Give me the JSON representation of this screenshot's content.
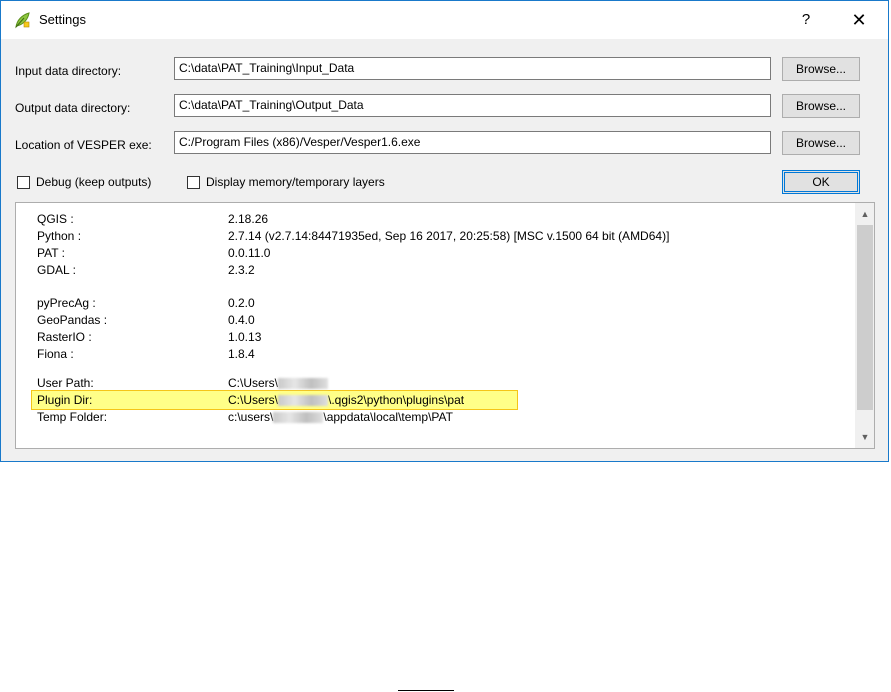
{
  "window": {
    "title": "Settings",
    "help_label": "?",
    "close_label": "✕"
  },
  "fields": [
    {
      "label": "Input data directory:",
      "value": "C:\\data\\PAT_Training\\Input_Data",
      "button": "Browse..."
    },
    {
      "label": "Output data directory:",
      "value": "C:\\data\\PAT_Training\\Output_Data",
      "button": "Browse..."
    },
    {
      "label": "Location of VESPER exe:",
      "value": "C:/Program Files (x86)/Vesper/Vesper1.6.exe",
      "button": "Browse..."
    }
  ],
  "options": {
    "debug_label": "Debug (keep outputs)",
    "debug_checked": false,
    "display_layers_label": "Display memory/temporary layers",
    "display_layers_checked": false,
    "ok_label": "OK"
  },
  "info": {
    "versions": [
      {
        "key": "QGIS :",
        "value": "2.18.26"
      },
      {
        "key": "Python :",
        "value": "2.7.14 (v2.7.14:84471935ed, Sep 16 2017, 20:25:58) [MSC v.1500 64 bit (AMD64)]"
      },
      {
        "key": "PAT :",
        "value": "0.0.11.0"
      },
      {
        "key": "GDAL :",
        "value": "2.3.2"
      }
    ],
    "libraries": [
      {
        "key": "pyPrecAg :",
        "value": "0.2.0"
      },
      {
        "key": "GeoPandas :",
        "value": "0.4.0"
      },
      {
        "key": "RasterIO :",
        "value": "1.0.13"
      },
      {
        "key": "Fiona :",
        "value": "1.8.4"
      }
    ],
    "paths": [
      {
        "key": "User Path:",
        "prefix": "C:\\Users\\",
        "suffix": ""
      },
      {
        "key": "Plugin Dir:",
        "prefix": "C:\\Users\\",
        "suffix": "\\.qgis2\\python\\plugins\\pat"
      },
      {
        "key": "Temp Folder:",
        "prefix": "c:\\users\\",
        "suffix": "\\appdata\\local\\temp\\PAT"
      }
    ]
  },
  "scrollbar": {
    "up": "▲",
    "down": "▼"
  },
  "colors": {
    "highlight": "#ffff88",
    "accent": "#0078d7",
    "window_border": "#1979ca"
  }
}
